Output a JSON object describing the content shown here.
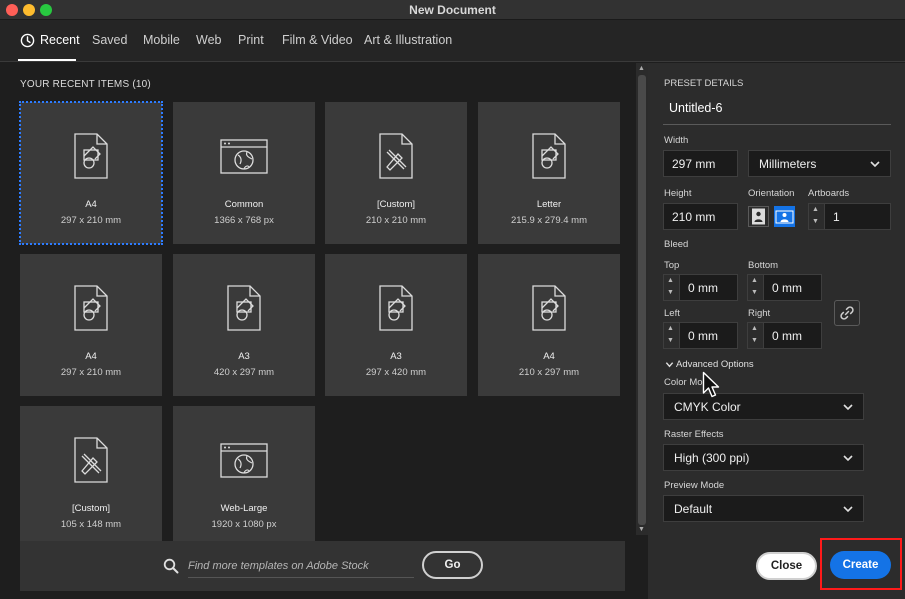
{
  "window": {
    "title": "New Document"
  },
  "tabs": [
    {
      "label": "Recent",
      "active": true
    },
    {
      "label": "Saved"
    },
    {
      "label": "Mobile"
    },
    {
      "label": "Web"
    },
    {
      "label": "Print"
    },
    {
      "label": "Film & Video"
    },
    {
      "label": "Art & Illustration"
    }
  ],
  "recent": {
    "title": "YOUR RECENT ITEMS",
    "count": "(10)",
    "items": [
      {
        "name": "A4",
        "size": "297 x 210 mm",
        "icon": "document-shapes-icon",
        "selected": true
      },
      {
        "name": "Common",
        "size": "1366 x 768 px",
        "icon": "web-browser-globe-icon"
      },
      {
        "name": "[Custom]",
        "size": "210 x 210 mm",
        "icon": "document-pen-icon"
      },
      {
        "name": "Letter",
        "size": "215.9 x 279.4 mm",
        "icon": "document-shapes-icon"
      },
      {
        "name": "A4",
        "size": "297 x 210 mm",
        "icon": "document-shapes-icon"
      },
      {
        "name": "A3",
        "size": "420 x 297 mm",
        "icon": "document-shapes-icon"
      },
      {
        "name": "A3",
        "size": "297 x 420 mm",
        "icon": "document-shapes-icon"
      },
      {
        "name": "A4",
        "size": "210 x 297 mm",
        "icon": "document-shapes-icon"
      },
      {
        "name": "[Custom]",
        "size": "105 x 148 mm",
        "icon": "document-pen-icon"
      },
      {
        "name": "Web-Large",
        "size": "1920 x 1080 px",
        "icon": "web-browser-globe-icon"
      }
    ]
  },
  "search": {
    "placeholder": "Find more templates on Adobe Stock",
    "go_label": "Go"
  },
  "preset": {
    "section_label": "PRESET DETAILS",
    "name": "Untitled-6",
    "width_label": "Width",
    "width_value": "297 mm",
    "units": "Millimeters",
    "height_label": "Height",
    "height_value": "210 mm",
    "orientation_label": "Orientation",
    "artboards_label": "Artboards",
    "artboards_value": "1",
    "bleed_label": "Bleed",
    "top_label": "Top",
    "top_value": "0 mm",
    "bottom_label": "Bottom",
    "bottom_value": "0 mm",
    "left_label": "Left",
    "left_value": "0 mm",
    "right_label": "Right",
    "right_value": "0 mm",
    "advanced_label": "Advanced Options",
    "color_mode_label": "Color Mo",
    "color_mode_value": "CMYK Color",
    "raster_label": "Raster Effects",
    "raster_value": "High (300 ppi)",
    "preview_label": "Preview Mode",
    "preview_value": "Default"
  },
  "actions": {
    "close_label": "Close",
    "create_label": "Create"
  },
  "colors": {
    "accent": "#1473e6",
    "highlight": "#ff1a1a",
    "selection": "#2d7cff"
  }
}
